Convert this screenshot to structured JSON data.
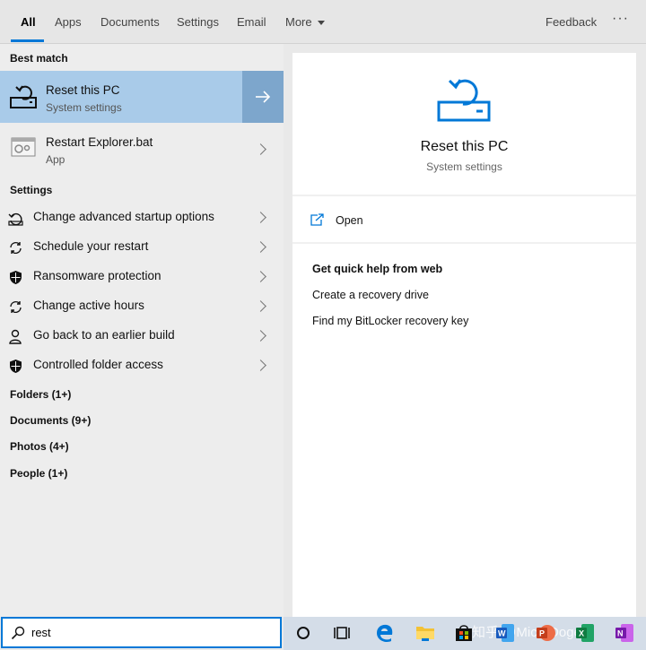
{
  "nav": {
    "tabs": [
      "All",
      "Apps",
      "Documents",
      "Settings",
      "Email",
      "More"
    ],
    "feedback": "Feedback",
    "ellipsis": "···"
  },
  "left": {
    "best_match_title": "Best match",
    "best_match": {
      "title": "Reset this PC",
      "subtitle": "System settings"
    },
    "app": {
      "title": "Restart Explorer.bat",
      "subtitle": "App"
    },
    "settings_title": "Settings",
    "settings": [
      {
        "label": "Change advanced startup options",
        "icon": "restart-icon"
      },
      {
        "label": "Schedule your restart",
        "icon": "sync-icon"
      },
      {
        "label": "Ransomware protection",
        "icon": "shield-icon"
      },
      {
        "label": "Change active hours",
        "icon": "sync-icon"
      },
      {
        "label": "Go back to an earlier build",
        "icon": "person-icon"
      },
      {
        "label": "Controlled folder access",
        "icon": "shield-icon"
      }
    ],
    "categories": [
      "Folders (1+)",
      "Documents (9+)",
      "Photos (4+)",
      "People (1+)"
    ]
  },
  "right": {
    "title": "Reset this PC",
    "subtitle": "System settings",
    "open": "Open",
    "help_title": "Get quick help from web",
    "help_links": [
      "Create a recovery drive",
      "Find my BitLocker recovery key"
    ]
  },
  "search": {
    "value": "rest"
  },
  "taskbar": {
    "watermark": "知乎 @MicroDoge",
    "icons": [
      "cortana-icon",
      "task-view-icon",
      "edge-icon",
      "file-explorer-icon",
      "store-icon",
      "word-icon",
      "powerpoint-icon",
      "excel-icon",
      "onenote-icon"
    ]
  },
  "colors": {
    "accent": "#0078d7",
    "selected": "#a9cbe9",
    "selected_arrow": "#7da6cc"
  }
}
